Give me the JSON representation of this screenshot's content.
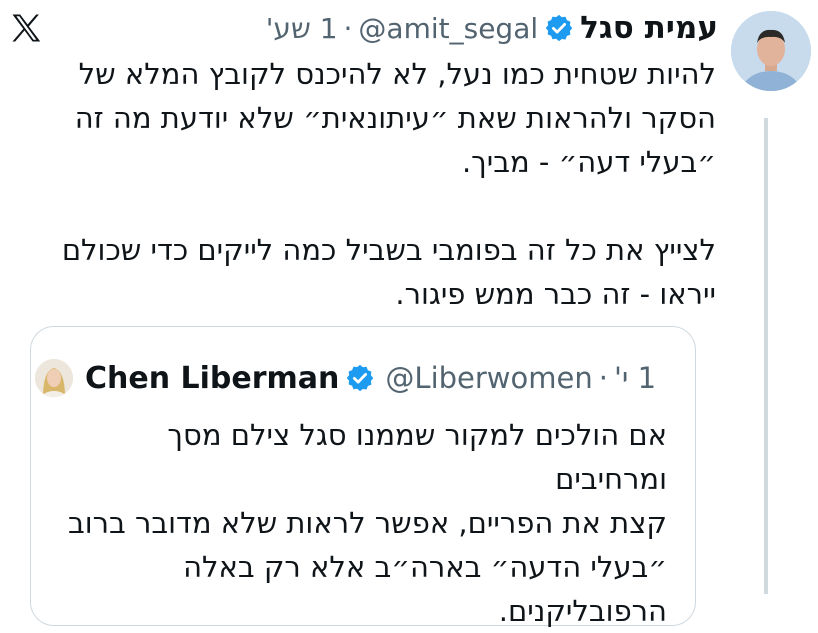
{
  "tweet": {
    "author_name": "עמית סגל",
    "handle": "@amit_segal",
    "separator": "·",
    "time": "1 שע'",
    "text_lines": [
      "להיות שטחית כמו נעל, לא להיכנס לקובץ המלא של",
      "הסקר ולהראות שאת ״עיתונאית״ שלא יודעת מה זה",
      "״בעלי דעה״ - מביך."
    ],
    "text_lines_2": [
      "לצייץ את כל זה בפומבי בשביל כמה לייקים כדי שכולם",
      "ייראו - זה כבר ממש פיגור."
    ]
  },
  "quoted_tweet": {
    "author_name": "Chen Liberman",
    "handle": "@Liberwomen",
    "separator": "·",
    "time": "1 י'",
    "text_lines": [
      "אם הולכים למקור שממנו סגל צילם מסך ומרחיבים",
      "קצת את הפריים, אפשר לראות שלא מדובר ברוב",
      "״בעלי הדעה״ בארה״ב אלא רק באלה",
      "הרפובליקנים."
    ]
  },
  "icons": {
    "x_logo": "x-logo-icon",
    "verified": "verified-badge-icon",
    "verified_color": "#1d9bf0"
  }
}
